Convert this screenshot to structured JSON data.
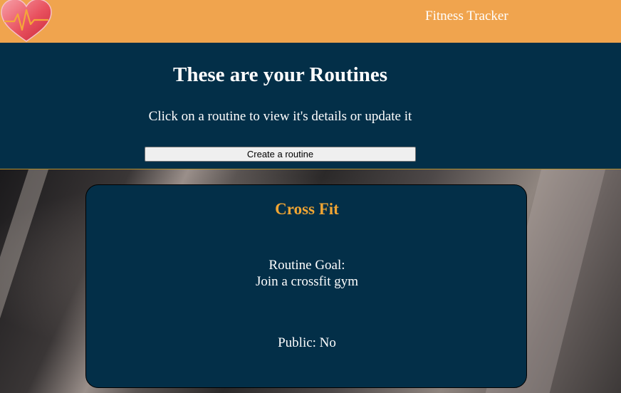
{
  "navbar": {
    "title": "Fitness Tracker",
    "logo_icon": "heart-pulse-icon",
    "background_color": "#f0a44e"
  },
  "header": {
    "title": "These are your Routines",
    "subtitle": "Click on a routine to view it's details or update it",
    "create_button_label": "Create a routine",
    "background_color": "#032f48"
  },
  "routines": [
    {
      "name": "Cross Fit",
      "goal_label": "Routine Goal:",
      "goal": "Join a crossfit gym",
      "public": "Public: No"
    }
  ],
  "colors": {
    "accent": "#f0a533",
    "card": "#032f48"
  }
}
